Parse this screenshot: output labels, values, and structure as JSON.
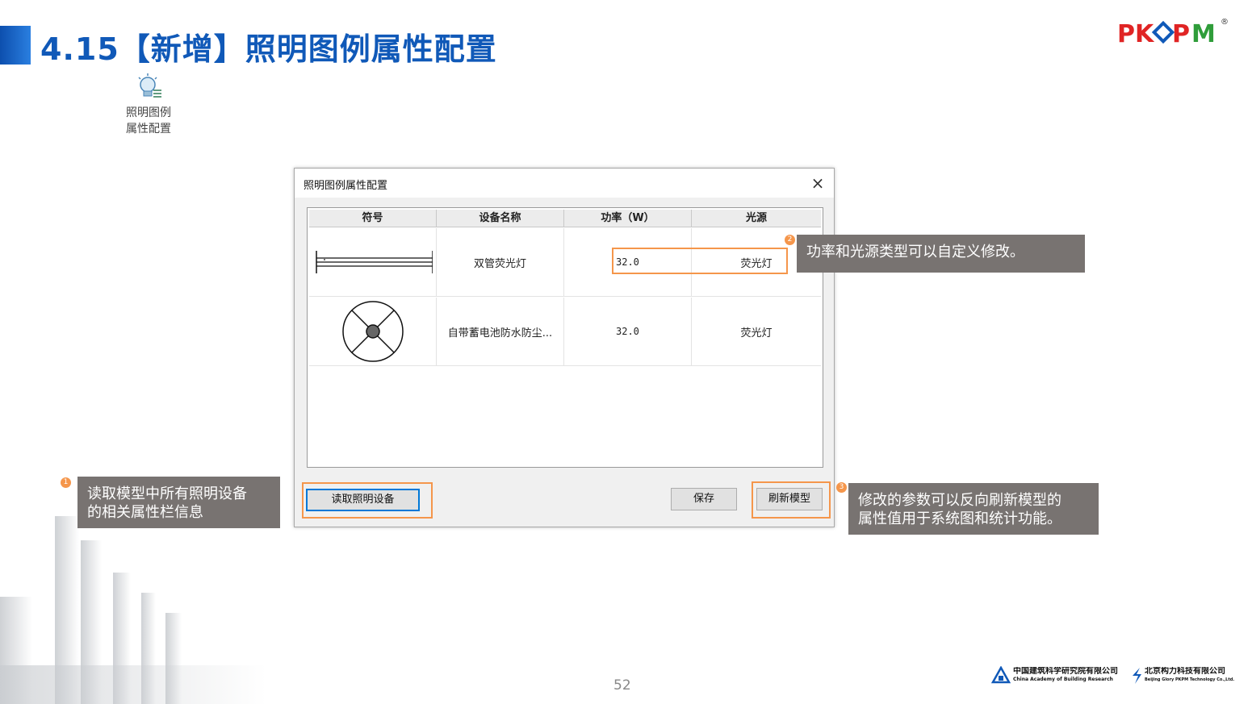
{
  "slide": {
    "title": "4.15【新增】照明图例属性配置",
    "page_number": "52"
  },
  "brand": {
    "logo_text": "PKPM",
    "registered": "®",
    "colors": {
      "p": "#e02424",
      "k": "#e02424",
      "diamond": "#1059b8",
      "m": "#2f9d3a"
    }
  },
  "ribbon": {
    "icon": "lightbulb-settings-icon",
    "label_line1": "照明图例",
    "label_line2": "属性配置"
  },
  "dialog": {
    "title": "照明图例属性配置",
    "close_glyph": "×",
    "columns": [
      "符号",
      "设备名称",
      "功率（W）",
      "光源"
    ],
    "rows": [
      {
        "symbol": "double-tube-fluorescent-symbol",
        "name": "双管荧光灯",
        "power": "32.0",
        "source": "荧光灯"
      },
      {
        "symbol": "waterproof-lamp-symbol",
        "name": "自带蓄电池防水防尘...",
        "power": "32.0",
        "source": "荧光灯"
      }
    ],
    "buttons": {
      "read": "读取照明设备",
      "save": "保存",
      "refresh": "刷新模型"
    }
  },
  "annotations": {
    "accent": "#f5964b",
    "callout_bg": "#787371",
    "c1": {
      "marker": "1",
      "line1": "读取模型中所有照明设备",
      "line2": "的相关属性栏信息"
    },
    "c2": {
      "marker": "2",
      "line1": "功率和光源类型可以自定义修改。"
    },
    "c3": {
      "marker": "3",
      "line1": "修改的参数可以反向刷新模型的",
      "line2": "属性值用于系统图和统计功能。"
    }
  },
  "footer": {
    "org1_cn": "中国建筑科学研究院有限公司",
    "org1_en": "China Academy of Building Research",
    "org2_cn": "北京构力科技有限公司",
    "org2_en": "Beijing Glory PKPM Technology Co.,Ltd."
  }
}
